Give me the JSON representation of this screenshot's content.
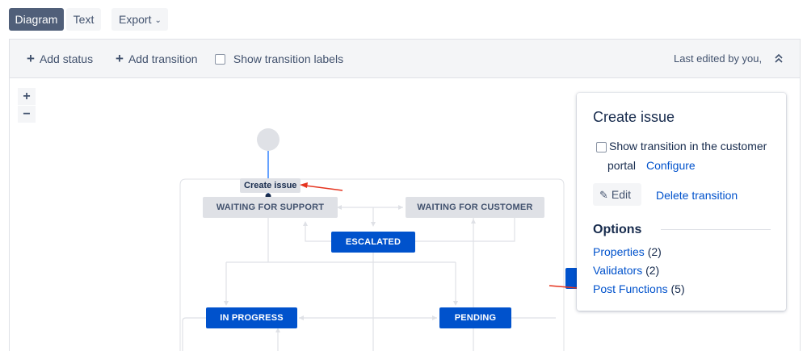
{
  "view_tabs": [
    {
      "label": "Diagram",
      "active": true
    },
    {
      "label": "Text",
      "active": false
    }
  ],
  "export_label": "Export",
  "toolbar": {
    "add_status": "Add status",
    "add_transition": "Add transition",
    "show_labels": "Show transition labels",
    "last_edited": "Last edited by you,"
  },
  "zoom": {
    "in": "+",
    "out": "−"
  },
  "diagram": {
    "statuses": [
      {
        "name": "WAITING FOR SUPPORT",
        "category": "grey"
      },
      {
        "name": "WAITING FOR CUSTOMER",
        "category": "grey"
      },
      {
        "name": "ESCALATED",
        "category": "blue"
      },
      {
        "name": "IN PROGRESS",
        "category": "blue"
      },
      {
        "name": "PENDING",
        "category": "blue"
      }
    ],
    "transition_label": "Create issue"
  },
  "panel": {
    "title": "Create issue",
    "portal_line1": "Show transition in the customer",
    "portal_line2": "portal",
    "configure": "Configure",
    "edit": "Edit",
    "delete": "Delete transition",
    "options_title": "Options",
    "options": [
      {
        "label": "Properties",
        "count": "(2)"
      },
      {
        "label": "Validators",
        "count": "(2)"
      },
      {
        "label": "Post Functions",
        "count": "(5)"
      }
    ]
  },
  "colors": {
    "accent_blue": "#0052cc",
    "grey_status": "#dfe1e6",
    "annotation_red": "#e5341f",
    "toolbar_bg": "#f4f5f7"
  }
}
